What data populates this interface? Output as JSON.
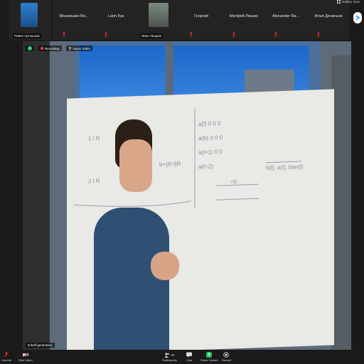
{
  "gallery": {
    "view_label": "Gallery View",
    "participants": [
      {
        "name": "",
        "nameplate": "Павел Артюшков",
        "avatar": "photo"
      },
      {
        "name": "Мешкошин Ве...",
        "nameplate": ""
      },
      {
        "name": "Larin Ilya",
        "nameplate": ""
      },
      {
        "name": "",
        "nameplate": "Иван Лещков",
        "avatar": "photo"
      },
      {
        "name": "Георгий",
        "nameplate": ""
      },
      {
        "name": "Матфей Люшко",
        "nameplate": ""
      },
      {
        "name": "Alexander Ra...",
        "nameplate": ""
      },
      {
        "name": "Илья Денисьев",
        "nameplate": ""
      }
    ]
  },
  "main_video": {
    "recording_label": "Recording",
    "unpin_label": "Unpin Video",
    "speaker_name": "tinkoff-generation"
  },
  "toolbar": {
    "participants_count": "22",
    "participants_label": "Participants",
    "chat_label": "Chat",
    "share_label": "Share Screen",
    "record_label": "Record",
    "left1_label": "Unmute",
    "left2_label": "Start Video"
  },
  "colors": {
    "accent_blue": "#2d8cff",
    "share_green": "#22c55e",
    "mic_red": "#e0302e"
  }
}
